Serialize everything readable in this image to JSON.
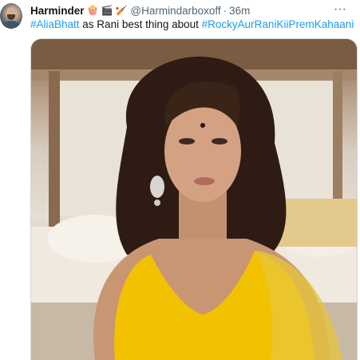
{
  "tweet": {
    "display_name": "Harminder",
    "emoji_badges": [
      "🍿",
      "🎬",
      "🏏"
    ],
    "handle": "@Harmindarboxoff",
    "separator": "·",
    "time": "36m",
    "more_label": "···",
    "text": {
      "hashtag_1": "#AliaBhatt",
      "middle": " as Rani best thing about ",
      "hashtag_2": "#RockyAurRaniKiiPremKahaani"
    },
    "media_icon": "photo-icon",
    "colors": {
      "link": "#1d9bf0",
      "name": "#0f1419",
      "muted": "#536471"
    }
  }
}
